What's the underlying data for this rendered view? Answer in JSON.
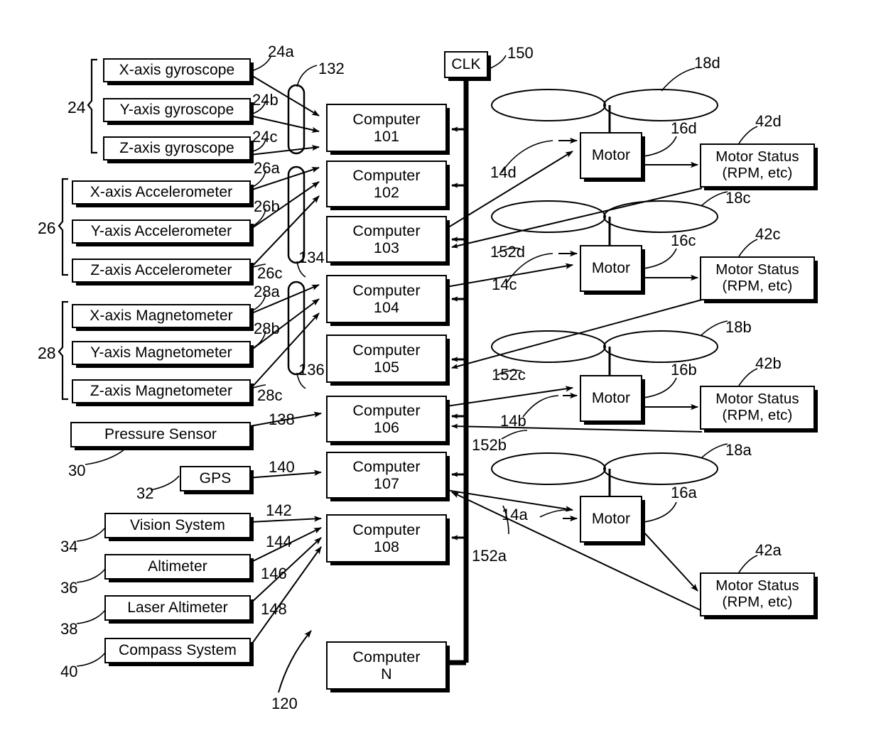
{
  "figure": {
    "title": "Multi-computer flight control system block diagram",
    "system_ref": "120",
    "bus_ref": "150"
  },
  "clock": {
    "label": "CLK",
    "ref": "150"
  },
  "sensor_groups": [
    {
      "group_ref": "24",
      "items": [
        {
          "label": "X-axis gyroscope",
          "ref": "24a",
          "signal": "132"
        },
        {
          "label": "Y-axis gyroscope",
          "ref": "24b",
          "signal": "132"
        },
        {
          "label": "Z-axis gyroscope",
          "ref": "24c",
          "signal": "132"
        }
      ]
    },
    {
      "group_ref": "26",
      "items": [
        {
          "label": "X-axis Accelerometer",
          "ref": "26a",
          "signal": "134"
        },
        {
          "label": "Y-axis Accelerometer",
          "ref": "26b",
          "signal": "134"
        },
        {
          "label": "Z-axis Accelerometer",
          "ref": "26c",
          "signal": "134"
        }
      ]
    },
    {
      "group_ref": "28",
      "items": [
        {
          "label": "X-axis Magnetometer",
          "ref": "28a",
          "signal": "136"
        },
        {
          "label": "Y-axis Magnetometer",
          "ref": "28b",
          "signal": "136"
        },
        {
          "label": "Z-axis Magnetometer",
          "ref": "28c",
          "signal": "136"
        }
      ]
    }
  ],
  "bundle_refs": [
    "132",
    "134",
    "136"
  ],
  "single_sensors": [
    {
      "label": "Pressure Sensor",
      "ref": "30",
      "signal": "138"
    },
    {
      "label": "GPS",
      "ref": "32",
      "signal": "140"
    },
    {
      "label": "Vision System",
      "ref": "34",
      "signal": "142"
    },
    {
      "label": "Altimeter",
      "ref": "36",
      "signal": "144"
    },
    {
      "label": "Laser Altimeter",
      "ref": "38",
      "signal": "146"
    },
    {
      "label": "Compass System",
      "ref": "40",
      "signal": "148"
    }
  ],
  "computers": [
    {
      "line1": "Computer",
      "line2": "101"
    },
    {
      "line1": "Computer",
      "line2": "102"
    },
    {
      "line1": "Computer",
      "line2": "103"
    },
    {
      "line1": "Computer",
      "line2": "104"
    },
    {
      "line1": "Computer",
      "line2": "105"
    },
    {
      "line1": "Computer",
      "line2": "106"
    },
    {
      "line1": "Computer",
      "line2": "107"
    },
    {
      "line1": "Computer",
      "line2": "108"
    },
    {
      "line1": "Computer",
      "line2": "N"
    }
  ],
  "rotor_assemblies": [
    {
      "propeller_ref": "18d",
      "motor_label": "Motor",
      "motor_ref": "16d",
      "command_ref": "14d",
      "status_ref": "152d",
      "status_line1": "Motor Status",
      "status_line2": "(RPM, etc)",
      "status_box_ref": "42d"
    },
    {
      "propeller_ref": "18c",
      "motor_label": "Motor",
      "motor_ref": "16c",
      "command_ref": "14c",
      "status_ref": "152c",
      "status_line1": "Motor Status",
      "status_line2": "(RPM, etc)",
      "status_box_ref": "42c"
    },
    {
      "propeller_ref": "18b",
      "motor_label": "Motor",
      "motor_ref": "16b",
      "command_ref": "14b",
      "status_ref": "152b",
      "status_line1": "Motor Status",
      "status_line2": "(RPM, etc)",
      "status_box_ref": "42b"
    },
    {
      "propeller_ref": "18a",
      "motor_label": "Motor",
      "motor_ref": "16a",
      "command_ref": "14a",
      "status_ref": "152a",
      "status_line1": "Motor Status",
      "status_line2": "(RPM, etc)",
      "status_box_ref": "42a"
    }
  ]
}
